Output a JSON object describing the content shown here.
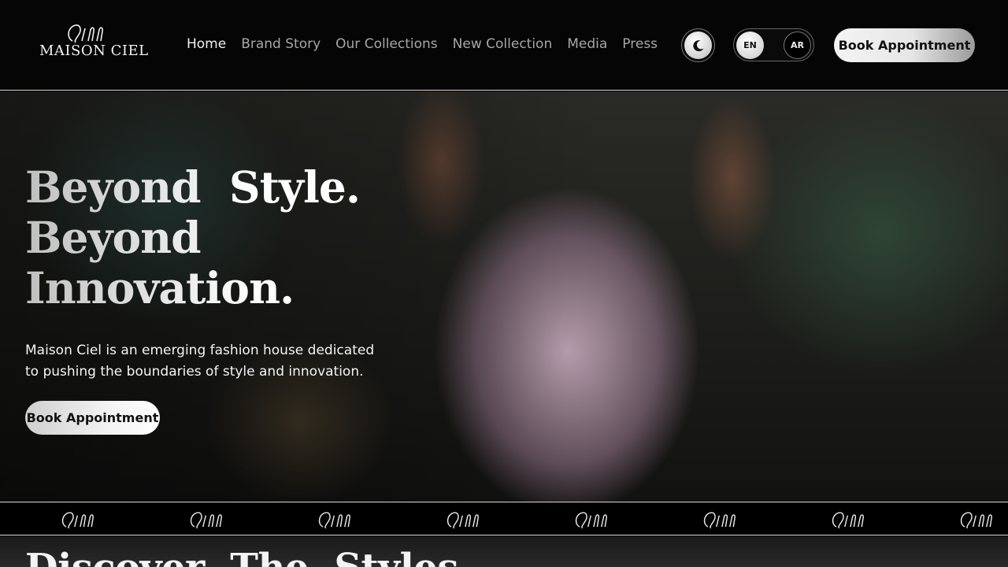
{
  "brand": {
    "name": "MAISON CIEL"
  },
  "nav": {
    "items": [
      {
        "label": "Home",
        "active": true
      },
      {
        "label": "Brand Story",
        "active": false
      },
      {
        "label": "Our Collections",
        "active": false
      },
      {
        "label": "New Collection",
        "active": false
      },
      {
        "label": "Media",
        "active": false
      },
      {
        "label": "Press",
        "active": false
      }
    ]
  },
  "header": {
    "theme_icon": "moon-icon",
    "lang": {
      "en": "EN",
      "ar": "AR",
      "selected": "EN"
    },
    "book_label": "Book Appointment"
  },
  "hero": {
    "title_line1": "Beyond  Style.",
    "title_line2": "Beyond",
    "title_line3": "Innovation.",
    "description": "Maison Ciel is an emerging fashion house dedicated to pushing the boundaries of style and innovation.",
    "book_label": "Book Appointment"
  },
  "strip": {
    "icon": "brand-monogram-icon"
  },
  "section": {
    "title": "Discover  The  Styles"
  },
  "colors": {
    "background": "#050505",
    "text": "#ffffff",
    "muted": "#a6a6a6",
    "button": "#f2f2f2"
  }
}
